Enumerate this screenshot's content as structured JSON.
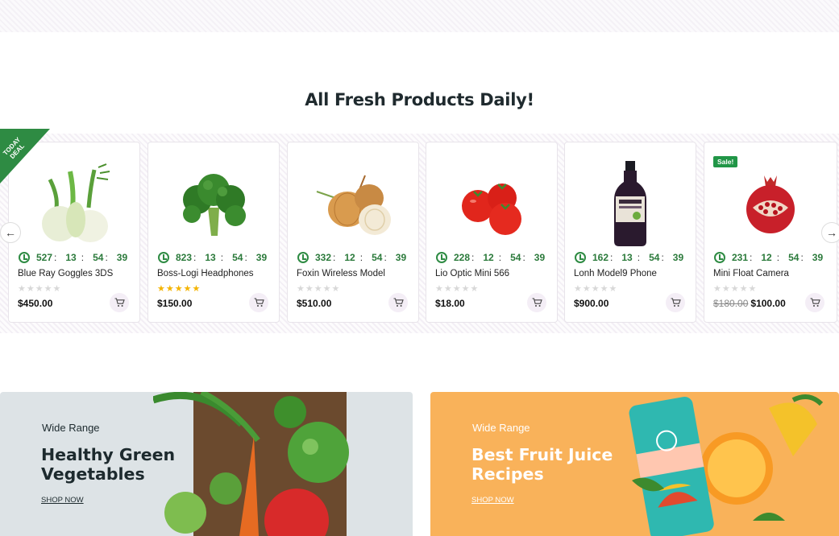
{
  "section_title": "All Fresh Products Daily!",
  "ribbon": "TODAY DEAL",
  "sale_badge": "Sale!",
  "products": [
    {
      "name": "Blue Ray Goggles 3DS",
      "price": "$450.00",
      "old_price": "",
      "rating": 0,
      "timer": [
        "527",
        "13",
        "54",
        "39"
      ]
    },
    {
      "name": "Boss-Logi Headphones",
      "price": "$150.00",
      "old_price": "",
      "rating": 5,
      "timer": [
        "823",
        "13",
        "54",
        "39"
      ]
    },
    {
      "name": "Foxin Wireless Model",
      "price": "$510.00",
      "old_price": "",
      "rating": 0,
      "timer": [
        "332",
        "12",
        "54",
        "39"
      ]
    },
    {
      "name": "Lio Optic Mini 566",
      "price": "$18.00",
      "old_price": "",
      "rating": 0,
      "timer": [
        "228",
        "12",
        "54",
        "39"
      ]
    },
    {
      "name": "Lonh Model9 Phone",
      "price": "$900.00",
      "old_price": "",
      "rating": 0,
      "timer": [
        "162",
        "13",
        "54",
        "39"
      ]
    },
    {
      "name": "Mini Float Camera",
      "price": "$100.00",
      "old_price": "$180.00",
      "rating": 0,
      "timer": [
        "231",
        "12",
        "54",
        "39"
      ]
    }
  ],
  "banners": [
    {
      "small": "Wide Range",
      "title_line1": "Healthy Green",
      "title_line2": "Vegetables",
      "link": "SHOP NOW"
    },
    {
      "small": "Wide Range",
      "title_line1": "Best Fruit Juice",
      "title_line2": "Recipes",
      "link": "SHOP NOW"
    }
  ],
  "colors": {
    "accent_green": "#2e8b43",
    "sale_green": "#219647",
    "banner_left_bg": "#dde3e6",
    "banner_right_bg": "#f9b25a",
    "star_gold": "#f4b400"
  }
}
